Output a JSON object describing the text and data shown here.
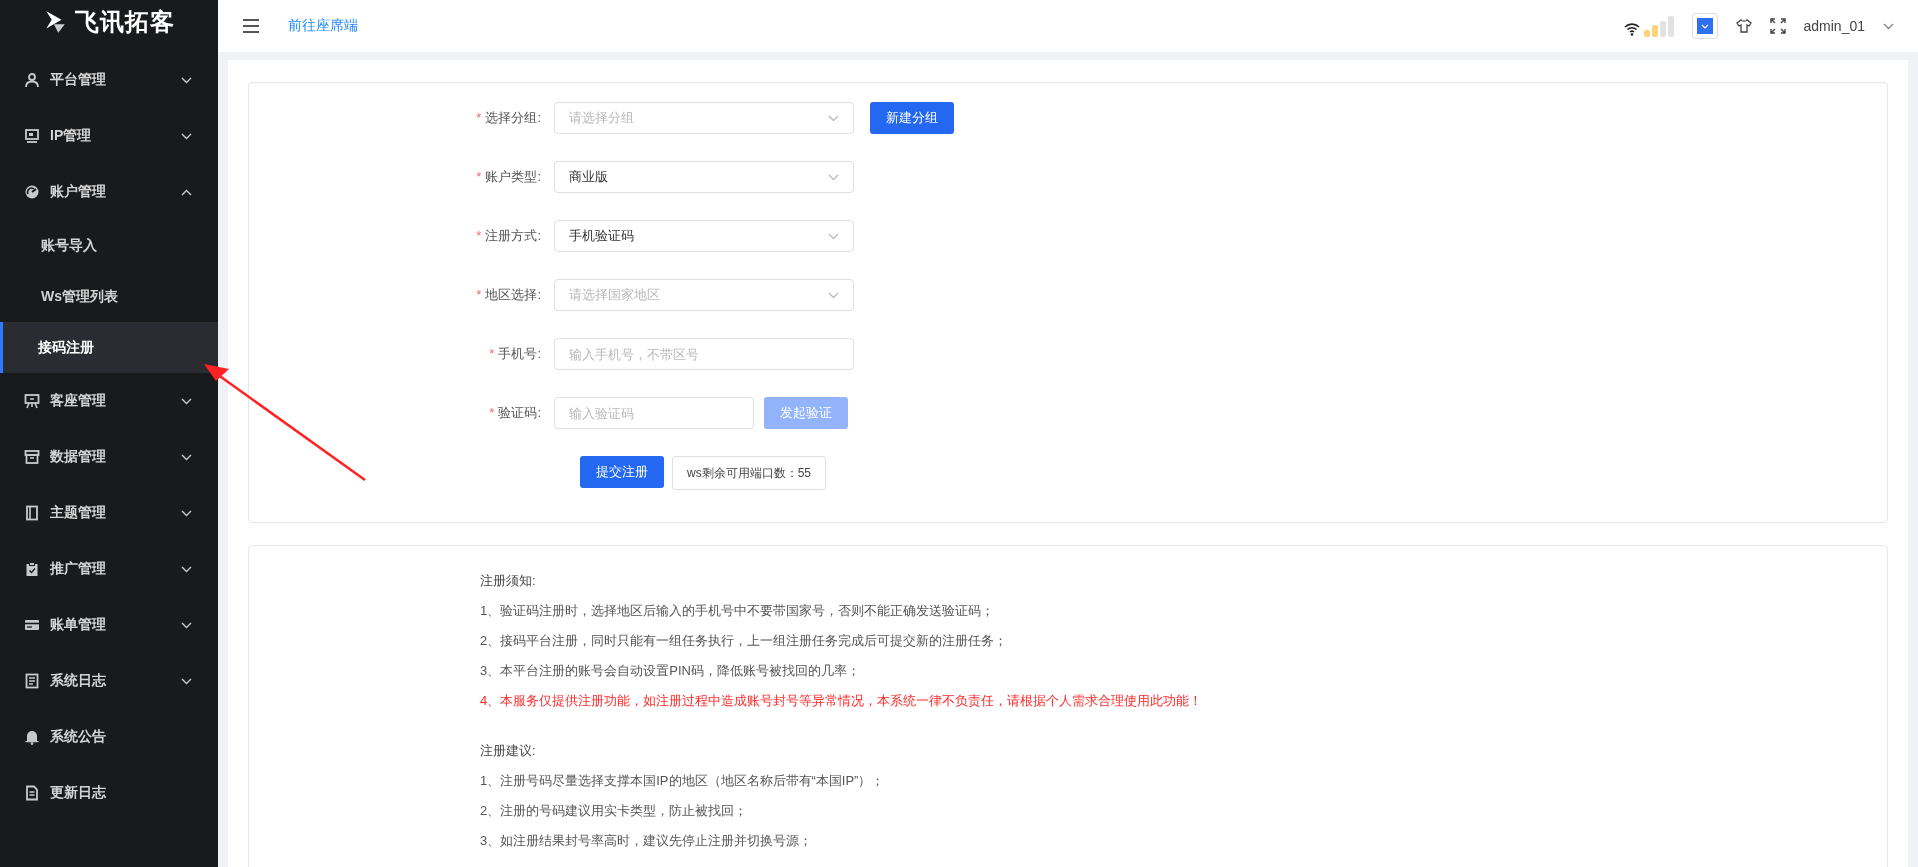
{
  "sidebar": {
    "logo": "飞讯拓客",
    "items": [
      {
        "label": "平台管理",
        "kind": "group",
        "expanded": false
      },
      {
        "label": "IP管理",
        "kind": "group",
        "expanded": false
      },
      {
        "label": "账户管理",
        "kind": "group",
        "expanded": true,
        "children": [
          {
            "label": "账号导入",
            "selected": false
          },
          {
            "label": "Ws管理列表",
            "selected": false
          },
          {
            "label": "接码注册",
            "selected": true
          }
        ]
      },
      {
        "label": "客座管理",
        "kind": "group",
        "expanded": false
      },
      {
        "label": "数据管理",
        "kind": "group",
        "expanded": false
      },
      {
        "label": "主题管理",
        "kind": "group",
        "expanded": false
      },
      {
        "label": "推广管理",
        "kind": "group",
        "expanded": false
      },
      {
        "label": "账单管理",
        "kind": "group",
        "expanded": false
      },
      {
        "label": "系统日志",
        "kind": "group",
        "expanded": false
      },
      {
        "label": "系统公告",
        "kind": "link"
      },
      {
        "label": "更新日志",
        "kind": "link"
      }
    ]
  },
  "header": {
    "link": "前往座席端",
    "user": "admin_01"
  },
  "form": {
    "fields": [
      {
        "label": "选择分组:",
        "required_mark": "*",
        "kind": "select",
        "placeholder": "请选择分组",
        "button": {
          "label": "新建分组",
          "disabled": false
        }
      },
      {
        "label": "账户类型:",
        "required_mark": "*",
        "kind": "select",
        "value": "商业版"
      },
      {
        "label": "注册方式:",
        "required_mark": "*",
        "kind": "select",
        "value": "手机验证码"
      },
      {
        "label": "地区选择:",
        "required_mark": "*",
        "kind": "select",
        "placeholder": "请选择国家地区"
      },
      {
        "label": "手机号:",
        "required_mark": "*",
        "kind": "input",
        "placeholder": "输入手机号，不带区号"
      },
      {
        "label": "验证码:",
        "required_mark": "*",
        "kind": "short-input",
        "placeholder": "输入验证码",
        "button": {
          "label": "发起验证",
          "disabled": true
        }
      }
    ],
    "submit": "提交注册",
    "port_info": "ws剩余可用端口数：55"
  },
  "notes": [
    {
      "title": "注册须知:",
      "items": [
        {
          "text": "1、验证码注册时，选择地区后输入的手机号中不要带国家号，否则不能正确发送验证码；",
          "warning": false
        },
        {
          "text": "2、接码平台注册，同时只能有一组任务执行，上一组注册任务完成后可提交新的注册任务；",
          "warning": false
        },
        {
          "text": "3、本平台注册的账号会自动设置PIN码，降低账号被找回的几率；",
          "warning": false
        },
        {
          "text": "4、本服务仅提供注册功能，如注册过程中造成账号封号等异常情况，本系统一律不负责任，请根据个人需求合理使用此功能！",
          "warning": true
        }
      ]
    },
    {
      "title": "注册建议:",
      "items": [
        {
          "text": "1、注册号码尽量选择支撑本国IP的地区（地区名称后带有“本国IP”）；",
          "warning": false
        },
        {
          "text": "2、注册的号码建议用实卡类型，防止被找回；",
          "warning": false
        },
        {
          "text": "3、如注册结果封号率高时，建议先停止注册并切换号源；",
          "warning": false
        }
      ]
    }
  ]
}
